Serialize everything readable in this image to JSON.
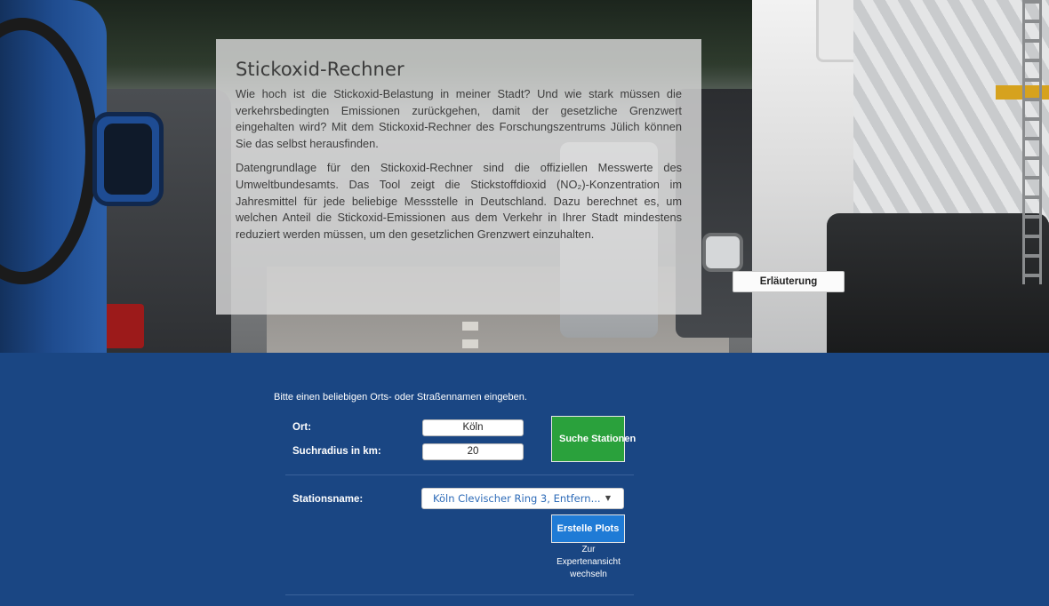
{
  "info": {
    "title": "Stickoxid-Rechner",
    "paragraph1": "Wie hoch ist die Stickoxid-Belastung in meiner Stadt? Und wie stark müssen die verkehrsbedingten Emissionen zurückgehen, damit der gesetzliche Grenzwert eingehalten wird? Mit dem Stickoxid-Rechner des Forschungszentrums Jülich können Sie das selbst herausfinden.",
    "paragraph2": "Datengrundlage für den Stickoxid-Rechner sind die offiziellen Messwerte des Umweltbundesamts. Das Tool zeigt die Stickstoffdioxid (NO₂)-Konzentration im Jahresmittel für jede beliebige Messstelle in Deutschland. Dazu berechnet es, um welchen Anteil die Stickoxid-Emissionen aus dem Verkehr in Ihrer Stadt mindestens reduziert werden müssen, um den gesetzlichen Grenzwert einzuhalten."
  },
  "buttons": {
    "erlaeuterung": "Erläuterung",
    "suche": "Suche Stationen",
    "plots": "Erstelle Plots"
  },
  "form": {
    "hint": "Bitte einen beliebigen Orts- oder Straßennamen eingeben.",
    "ort_label": "Ort:",
    "ort_value": "Köln",
    "radius_label": "Suchradius in km:",
    "radius_value": "20",
    "station_label": "Stationsname:",
    "station_value": "Köln Clevischer Ring 3, Entfern...",
    "expert_line1": "Zur",
    "expert_line2": "Expertenansicht",
    "expert_line3": "wechseln"
  },
  "colors": {
    "background_blue": "#1a4683",
    "search_green": "#2aa13c",
    "plots_blue": "#1f7bd6",
    "select_text": "#2d6bb8"
  },
  "icons": {
    "select_caret": "▼"
  }
}
